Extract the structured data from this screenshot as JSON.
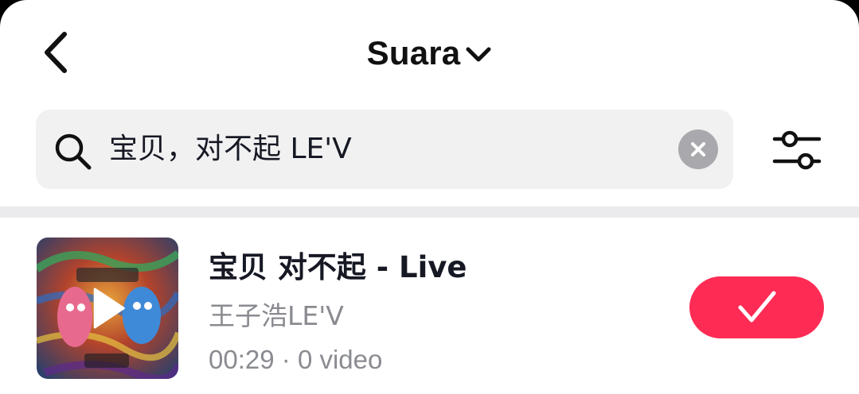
{
  "header": {
    "title": "Suara",
    "back_icon": "chevron-left-icon",
    "dropdown_icon": "chevron-down-icon"
  },
  "search": {
    "value": "宝贝，对不起 LE'V",
    "search_icon": "search-icon",
    "clear_icon": "clear-icon",
    "filter_icon": "filter-sliders-icon"
  },
  "results": [
    {
      "title": "宝贝 对不起 - Live",
      "artist": "王子浩LE'V",
      "duration": "00:29",
      "separator": "·",
      "video_count": "0 video",
      "selected": true,
      "select_icon": "checkmark-icon",
      "cover_icon": "play-icon"
    }
  ],
  "colors": {
    "accent": "#fe2c55",
    "text_primary": "#161823",
    "text_secondary": "#8a8b91",
    "search_bg": "#f1f1f2"
  }
}
